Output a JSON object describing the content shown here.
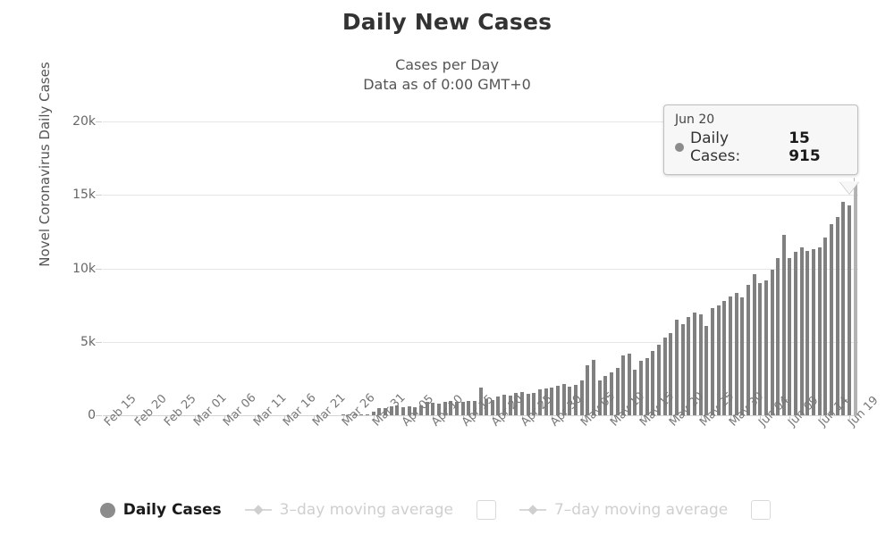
{
  "header": {
    "title": "Daily New Cases",
    "subtitle_line1": "Cases per Day",
    "subtitle_line2": "Data as of 0:00 GMT+0"
  },
  "tooltip": {
    "date": "Jun 20",
    "series_label": "Daily Cases:",
    "value": "15 915",
    "marker": "filled-circle"
  },
  "legend": {
    "items": [
      {
        "label": "Daily Cases",
        "marker": "filled-circle",
        "state": "active",
        "checkbox": false
      },
      {
        "label": "3–day moving average",
        "marker": "line-diamond",
        "state": "inactive",
        "checkbox": true
      },
      {
        "label": "7–day moving average",
        "marker": "line-diamond",
        "state": "inactive",
        "checkbox": true
      }
    ]
  },
  "chart_data": {
    "type": "bar",
    "title": "Daily New Cases",
    "subtitle": "Cases per Day\nData as of 0:00 GMT+0",
    "xlabel": "",
    "ylabel": "Novel Coronavirus Daily Cases",
    "ylim": [
      0,
      20000
    ],
    "ytick_labels": [
      "0",
      "5k",
      "10k",
      "15k",
      "20k"
    ],
    "ytick_values": [
      0,
      5000,
      10000,
      15000,
      20000
    ],
    "grid": true,
    "legend_position": "bottom",
    "bar_color": "#808080",
    "highlight_color": "#b3b3b3",
    "highlighted_index": 126,
    "xtick_step": 5,
    "xtick_labels": [
      "Feb 15",
      "Feb 20",
      "Feb 25",
      "Mar 01",
      "Mar 06",
      "Mar 11",
      "Mar 16",
      "Mar 21",
      "Mar 26",
      "Mar 31",
      "Apr 05",
      "Apr 10",
      "Apr 15",
      "Apr 20",
      "Apr 25",
      "Apr 30",
      "May 05",
      "May 10",
      "May 15",
      "May 20",
      "May 25",
      "May 30",
      "Jun 04",
      "Jun 09",
      "Jun 14",
      "Jun 19"
    ],
    "categories": [
      "Feb 15",
      "Feb 16",
      "Feb 17",
      "Feb 18",
      "Feb 19",
      "Feb 20",
      "Feb 21",
      "Feb 22",
      "Feb 23",
      "Feb 24",
      "Feb 25",
      "Feb 26",
      "Feb 27",
      "Feb 28",
      "Feb 29",
      "Mar 01",
      "Mar 02",
      "Mar 03",
      "Mar 04",
      "Mar 05",
      "Mar 06",
      "Mar 07",
      "Mar 08",
      "Mar 09",
      "Mar 10",
      "Mar 11",
      "Mar 12",
      "Mar 13",
      "Mar 14",
      "Mar 15",
      "Mar 16",
      "Mar 17",
      "Mar 18",
      "Mar 19",
      "Mar 20",
      "Mar 21",
      "Mar 22",
      "Mar 23",
      "Mar 24",
      "Mar 25",
      "Mar 26",
      "Mar 27",
      "Mar 28",
      "Mar 29",
      "Mar 30",
      "Mar 31",
      "Apr 01",
      "Apr 02",
      "Apr 03",
      "Apr 04",
      "Apr 05",
      "Apr 06",
      "Apr 07",
      "Apr 08",
      "Apr 09",
      "Apr 10",
      "Apr 11",
      "Apr 12",
      "Apr 13",
      "Apr 14",
      "Apr 15",
      "Apr 16",
      "Apr 17",
      "Apr 18",
      "Apr 19",
      "Apr 20",
      "Apr 21",
      "Apr 22",
      "Apr 23",
      "Apr 24",
      "Apr 25",
      "Apr 26",
      "Apr 27",
      "Apr 28",
      "Apr 29",
      "Apr 30",
      "May 01",
      "May 02",
      "May 03",
      "May 04",
      "May 05",
      "May 06",
      "May 07",
      "May 08",
      "May 09",
      "May 10",
      "May 11",
      "May 12",
      "May 13",
      "May 14",
      "May 15",
      "May 16",
      "May 17",
      "May 18",
      "May 19",
      "May 20",
      "May 21",
      "May 22",
      "May 23",
      "May 24",
      "May 25",
      "May 26",
      "May 27",
      "May 28",
      "May 29",
      "May 30",
      "May 31",
      "Jun 01",
      "Jun 02",
      "Jun 03",
      "Jun 04",
      "Jun 05",
      "Jun 06",
      "Jun 07",
      "Jun 08",
      "Jun 09",
      "Jun 10",
      "Jun 11",
      "Jun 12",
      "Jun 13",
      "Jun 14",
      "Jun 15",
      "Jun 16",
      "Jun 17",
      "Jun 18",
      "Jun 19",
      "Jun 20"
    ],
    "values": [
      0,
      0,
      0,
      0,
      0,
      0,
      0,
      0,
      0,
      0,
      0,
      0,
      0,
      0,
      0,
      0,
      0,
      0,
      0,
      0,
      0,
      0,
      0,
      0,
      0,
      0,
      0,
      0,
      0,
      0,
      0,
      0,
      0,
      0,
      0,
      0,
      0,
      0,
      0,
      0,
      70,
      60,
      90,
      60,
      60,
      250,
      500,
      500,
      600,
      650,
      550,
      600,
      550,
      700,
      900,
      850,
      800,
      900,
      950,
      900,
      900,
      950,
      1000,
      1900,
      1100,
      1050,
      1250,
      1400,
      1350,
      1500,
      1600,
      1450,
      1500,
      1750,
      1800,
      1900,
      2000,
      2100,
      1950,
      2050,
      2400,
      3400,
      3800,
      2400,
      2700,
      2900,
      3200,
      4100,
      4200,
      3100,
      3700,
      3900,
      4400,
      4800,
      5300,
      5600,
      6500,
      6200,
      6700,
      7000,
      6900,
      6100,
      7300,
      7500,
      7800,
      8100,
      8300,
      8000,
      8900,
      9600,
      9000,
      9200,
      9900,
      10700,
      12300,
      10700,
      11100,
      11400,
      11200,
      11300,
      11400,
      12100,
      13000,
      13500,
      14500,
      14300,
      15915
    ]
  }
}
